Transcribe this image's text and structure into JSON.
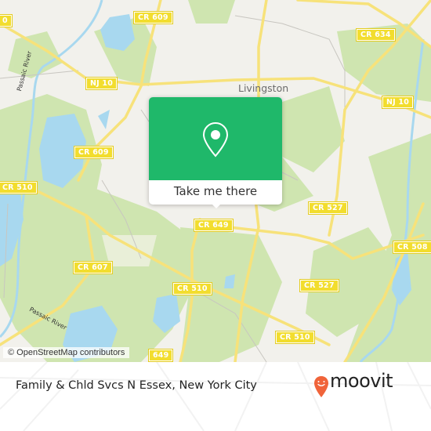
{
  "map": {
    "place_labels": [
      {
        "name": "livingston",
        "text": "Livingston"
      }
    ],
    "river_labels": [
      {
        "text": "Passaic River"
      },
      {
        "text": "Passaic River"
      }
    ],
    "road_shields": [
      {
        "text": "CR 609"
      },
      {
        "text": "0"
      },
      {
        "text": "NJ 10"
      },
      {
        "text": "CR 634"
      },
      {
        "text": "NJ 10"
      },
      {
        "text": "CR 609"
      },
      {
        "text": "CR 510"
      },
      {
        "text": "CR 649"
      },
      {
        "text": "CR 527"
      },
      {
        "text": "CR 508"
      },
      {
        "text": "CR 607"
      },
      {
        "text": "CR 510"
      },
      {
        "text": "CR 527"
      },
      {
        "text": "CR 510"
      },
      {
        "text": "649"
      }
    ],
    "attribution": "© OpenStreetMap contributors",
    "colors": {
      "land": "#f2f1ec",
      "park": "#cfe5b0",
      "water": "#a8d8ef",
      "road": "#f7e27a",
      "shield": "#f2dd2e"
    }
  },
  "popup": {
    "icon": "map-pin-icon",
    "cta_label": "Take me there",
    "accent": "#1fb86a"
  },
  "footer": {
    "title": "Family & Chld Svcs N Essex, New York City",
    "brand": "moovit",
    "brand_icon": "moovit-smiley-pin-icon",
    "brand_color": "#f0643a"
  }
}
